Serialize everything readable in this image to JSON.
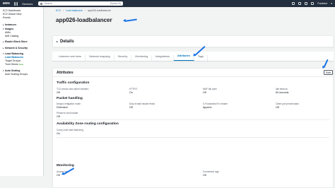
{
  "topbar": {
    "logo": "aws",
    "services_label": "Services",
    "search_placeholder": "Search",
    "search_hint": "[Option+S]",
    "region": "Frankfurt",
    "account": "▾"
  },
  "sidebar": {
    "top_items": [
      "EC2 Dashboard",
      "EC2 Global View",
      "Events"
    ],
    "groups": [
      {
        "label": "Instances",
        "items": []
      },
      {
        "label": "Images",
        "items": [
          "AMIs",
          "AMI Catalog"
        ]
      },
      {
        "label": "Elastic Block Store",
        "items": []
      },
      {
        "label": "Network & Security",
        "items": []
      },
      {
        "label": "Load Balancing",
        "items": [
          "Load Balancers",
          "Target Groups",
          "Trust Stores"
        ]
      },
      {
        "label": "Auto Scaling",
        "items": [
          "Auto Scaling Groups"
        ]
      }
    ],
    "trust_badge": "New"
  },
  "breadcrumb": [
    "EC2",
    "Load balancers",
    "app026-loadbalancer"
  ],
  "page_title": "app026-loadbalancer",
  "details_label": "Details",
  "tabs": [
    "Listeners and rules",
    "Network mapping",
    "Security",
    "Monitoring",
    "Integrations",
    "Attributes",
    "Tags"
  ],
  "active_tab": "Attributes",
  "attributes": {
    "title": "Attributes",
    "edit_label": "Edit",
    "traffic_configuration": {
      "title": "Traffic configuration",
      "fields": [
        {
          "k": "TLS version and cipher headers",
          "v": "Off"
        },
        {
          "k": "HTTP/2",
          "v": "On"
        },
        {
          "k": "WAF fail open",
          "v": "Off"
        },
        {
          "k": "Idle timeout",
          "v": "60 seconds"
        }
      ]
    },
    "packet_handling": {
      "title": "Packet handling",
      "fields": [
        {
          "k": "Desync mitigation mode",
          "v": "Defensive"
        },
        {
          "k": "Drop invalid header fields",
          "v": "Off"
        },
        {
          "k": "X-Forwarded-For header",
          "v": "Append"
        },
        {
          "k": "Client port preservation",
          "v": "Off"
        },
        {
          "k": "Preserve host header",
          "v": "Off"
        }
      ]
    },
    "az_routing": {
      "title": "Availability Zone routing configuration",
      "fields": [
        {
          "k": "Cross-zone load balancing",
          "v": "On"
        }
      ]
    },
    "monitoring": {
      "title": "Monitoring",
      "fields": [
        {
          "k": "Access logs",
          "v": "Off"
        },
        {
          "k": "Connection logs",
          "v": "Off"
        }
      ]
    }
  },
  "colors": {
    "annotation_arrow": "#1a73e8",
    "link": "#0073bb",
    "topbar": "#232f3e"
  }
}
